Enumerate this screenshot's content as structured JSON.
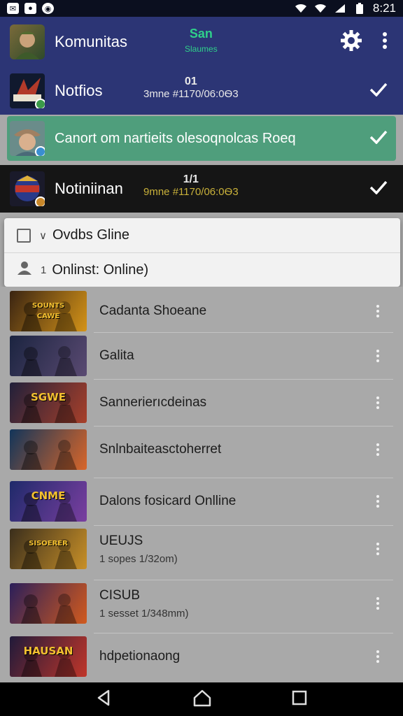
{
  "status_bar": {
    "time": "8:21",
    "left_icons": [
      "messenger-icon",
      "game-icon",
      "app-icon"
    ],
    "right_icons": [
      "wifi-icon",
      "wifi-icon",
      "signal-icon",
      "battery-icon"
    ]
  },
  "app_bar": {
    "title": "Komunitas",
    "center_primary": "San",
    "center_secondary": "Slaumes",
    "actions": [
      "gear-icon",
      "more-vert-icon"
    ]
  },
  "conversations": [
    {
      "label": "Notfios",
      "meta_top": "01",
      "meta_bottom": "3mne #1170/06:0Ѳ3",
      "checked": true
    },
    {
      "label": "Canort om nartieits olesoqnolcas Roeq",
      "checked": true
    },
    {
      "label": "Notiniinan",
      "meta_top": "1/1",
      "meta_bottom": "9mne #1170/06:0Ѳ3",
      "checked": true
    }
  ],
  "dropdown": {
    "item_1": "Ovdbs Gline",
    "item_1_marker": "∨",
    "item_2": "Onlinst: Online)",
    "item_2_marker": "1"
  },
  "games": [
    {
      "title": "Cadanta Shoeane",
      "subtitle": "",
      "thumb_text": "SOUNTS\nCAWE",
      "colors": [
        "#3a2412",
        "#d49318"
      ]
    },
    {
      "title": "Galita",
      "subtitle": "",
      "thumb_text": "",
      "colors": [
        "#1b2440",
        "#5a4a72"
      ]
    },
    {
      "title": "Sannerierıcdeinas",
      "subtitle": "",
      "thumb_text": "SGWE",
      "colors": [
        "#21203a",
        "#a8402a"
      ]
    },
    {
      "title": "Snlnbaiteasctoherret",
      "subtitle": "",
      "thumb_text": "",
      "colors": [
        "#12355a",
        "#d8662a"
      ]
    },
    {
      "title": "Dalons fosicard Onlline",
      "subtitle": "",
      "thumb_text": "CNME",
      "colors": [
        "#1f2a6a",
        "#7a3fa0"
      ]
    },
    {
      "title": "UEUJS",
      "subtitle": "1 sopes 1/32om)",
      "thumb_text": "SISOERER",
      "colors": [
        "#3a2e1c",
        "#c89028"
      ]
    },
    {
      "title": "CISUB",
      "subtitle": "1 sesset 1/348mm)",
      "thumb_text": "",
      "colors": [
        "#2b1f5a",
        "#d15a1e"
      ]
    },
    {
      "title": "hdpetionaong",
      "subtitle": "",
      "thumb_text": "HAUSAN",
      "colors": [
        "#201a3a",
        "#c0362a"
      ]
    }
  ],
  "nav_bar": [
    "back-icon",
    "home-icon",
    "recents-icon"
  ],
  "colors": {
    "app_bar": "#2c3575",
    "selected_row": "#4f9e7c",
    "dark_row": "#151515",
    "accent_green": "#2fd08a",
    "list_bg": "#a9a9a9"
  }
}
